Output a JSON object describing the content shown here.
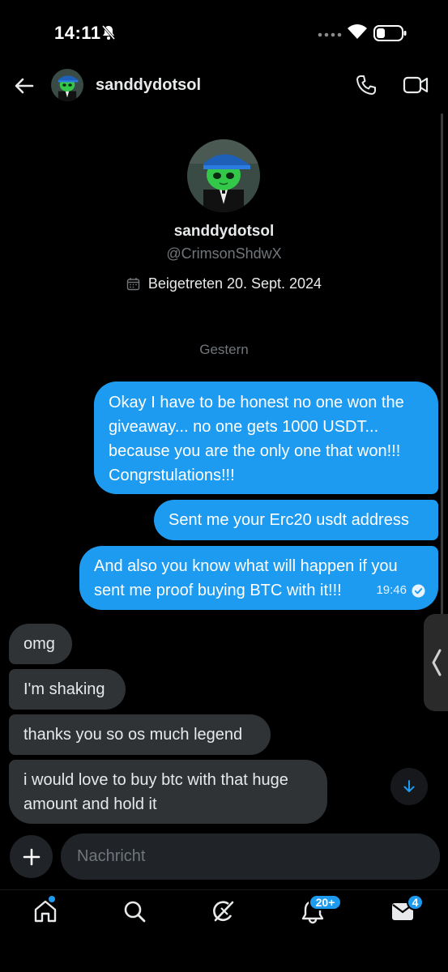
{
  "status_bar": {
    "time": "14:11"
  },
  "header": {
    "name": "sanddydotsol"
  },
  "profile": {
    "name": "sanddydotsol",
    "handle": "@CrimsonShdwX",
    "joined": "Beigetreten 20. Sept. 2024"
  },
  "date_separator": "Gestern",
  "messages": [
    {
      "direction": "outgoing",
      "text": "Okay I have to be honest no one won the giveaway... no one gets 1000 USDT... because you are the only one that won!!! Congrstulations!!!"
    },
    {
      "direction": "outgoing",
      "text": "Sent me your Erc20 usdt address"
    },
    {
      "direction": "outgoing",
      "text": "And also you know what will happen if you sent me proof buying BTC with it!!!",
      "time": "19:46"
    },
    {
      "direction": "incoming",
      "text": "omg"
    },
    {
      "direction": "incoming",
      "text": "I'm shaking"
    },
    {
      "direction": "incoming",
      "text": "thanks you so os much legend"
    },
    {
      "direction": "incoming",
      "text": "i would love to buy btc with that huge amount and hold it"
    }
  ],
  "composer": {
    "placeholder": "Nachricht"
  },
  "nav": {
    "items": [
      "home-icon",
      "search-icon",
      "grok-icon",
      "bell-icon",
      "mail-icon"
    ],
    "notifications_badge": "20+",
    "messages_badge": "4"
  },
  "colors": {
    "accent": "#1d9bf0",
    "incoming_bubble": "#2f3336",
    "background": "#000000"
  }
}
